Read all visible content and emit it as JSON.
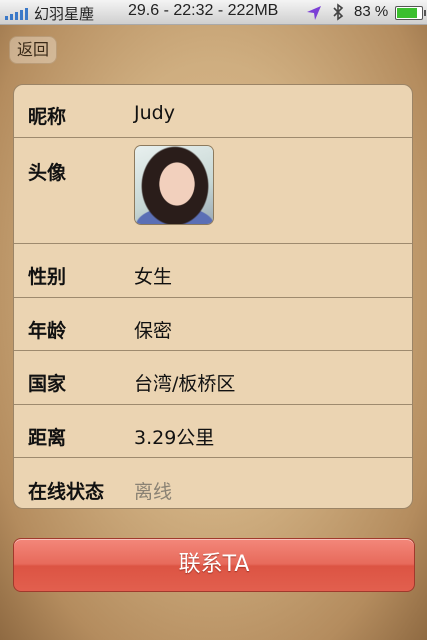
{
  "status_bar": {
    "carrier": "幻羽星塵",
    "clock": "29.6 - 22:32 - 222MB",
    "battery": "83 %",
    "battery_level": 0.83,
    "icons": [
      "signal-icon",
      "location-arrow-icon",
      "bluetooth-icon",
      "battery-icon"
    ]
  },
  "nav": {
    "back_label": "返回"
  },
  "profile": {
    "nickname_label": "昵称",
    "nickname": "Judy",
    "avatar_label": "头像",
    "gender_label": "性别",
    "gender": "女生",
    "age_label": "年龄",
    "age": "保密",
    "country_label": "国家",
    "country": "台湾/板桥区",
    "distance_label": "距离",
    "distance": "3.29公里",
    "status_label": "在线状态",
    "status": "离线"
  },
  "actions": {
    "contact_label": "联系TA"
  },
  "colors": {
    "accent": "#e2604f",
    "panel": "#ebd4b2",
    "offline": "#8a8274"
  }
}
